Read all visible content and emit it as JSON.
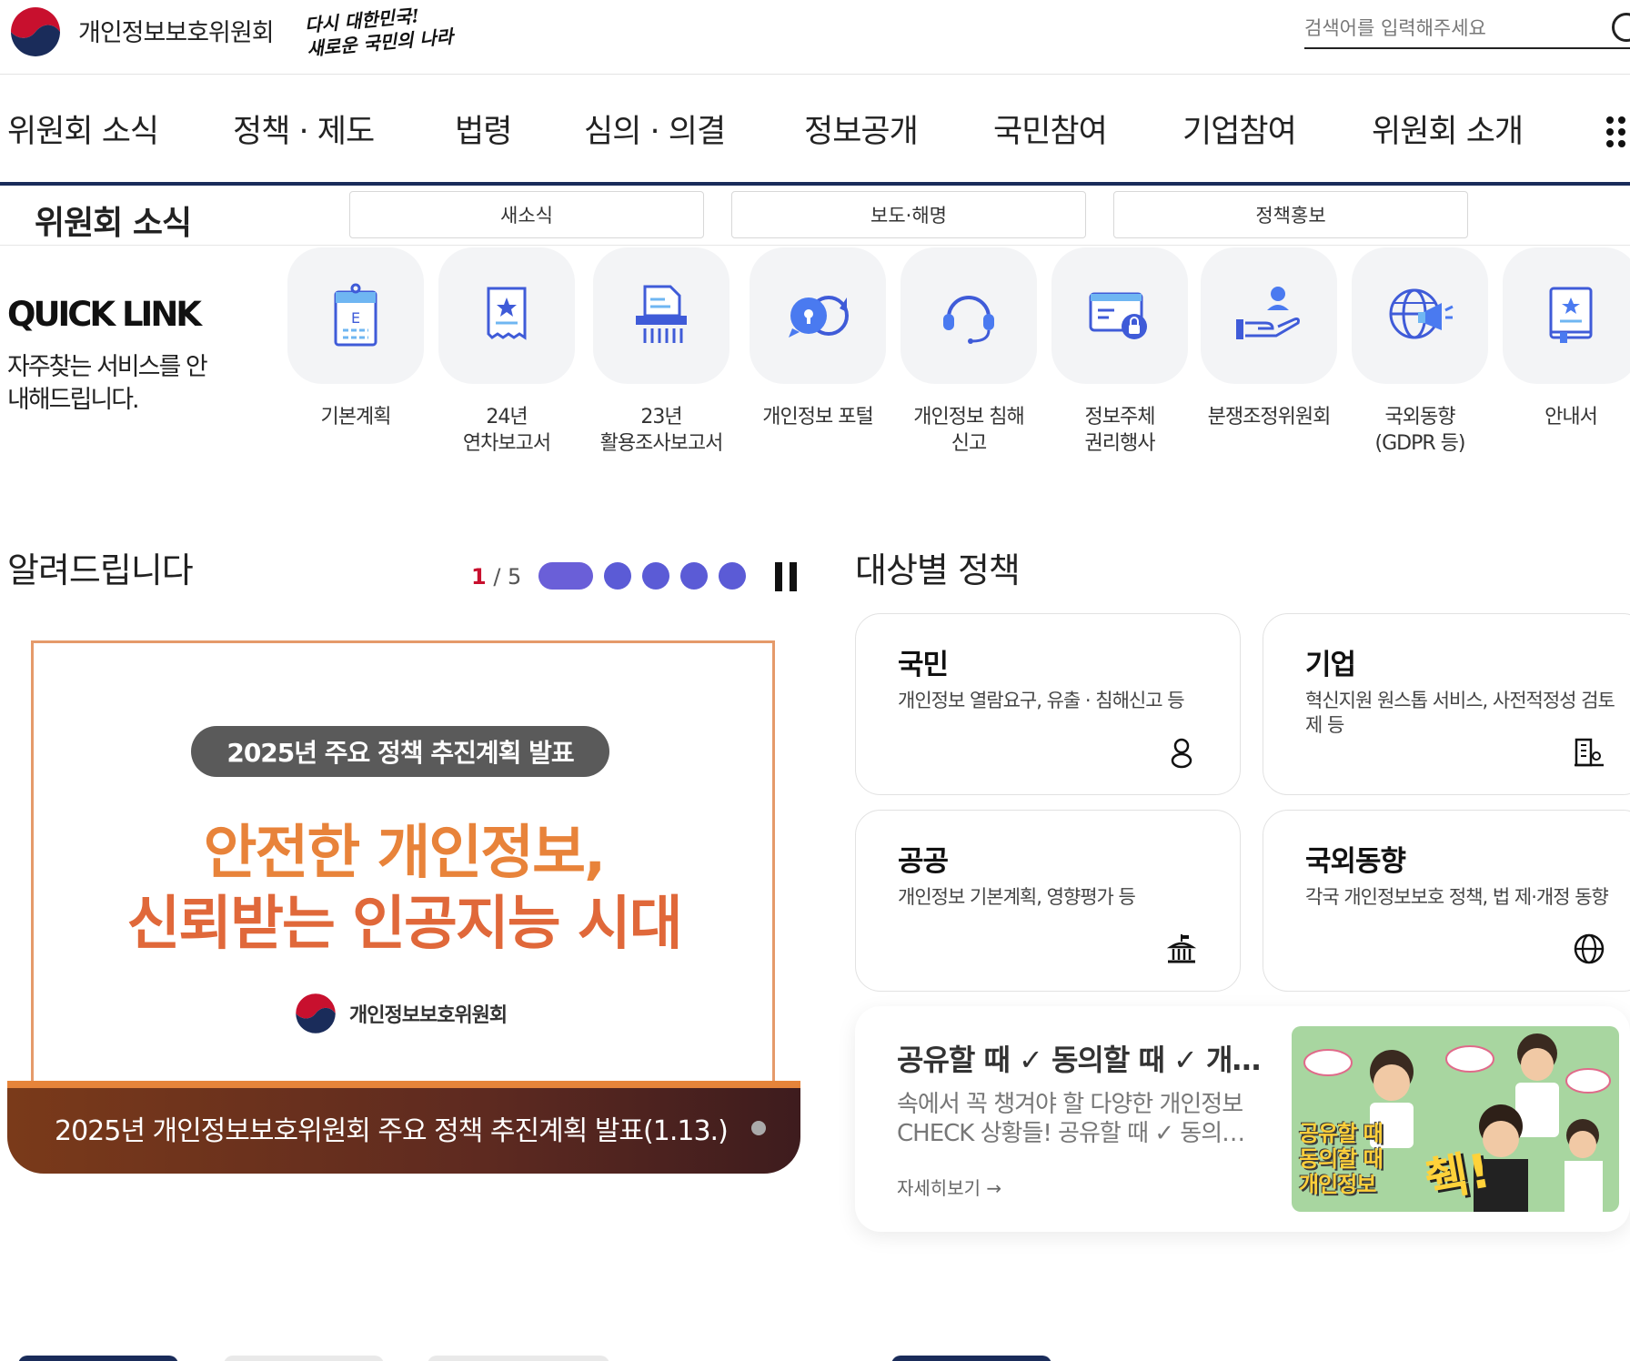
{
  "header": {
    "org_name": "개인정보보호위원회",
    "slogan_line1": "다시 대한민국!",
    "slogan_line2": "새로운 국민의 나라",
    "search_placeholder": "검색어를 입력해주세요"
  },
  "gnb": {
    "items": [
      "위원회 소식",
      "정책 · 제도",
      "법령",
      "심의 · 의결",
      "정보공개",
      "국민참여",
      "기업참여",
      "위원회 소개"
    ]
  },
  "lnb": {
    "title": "위원회 소식",
    "tabs": [
      "새소식",
      "보도·해명",
      "정책홍보"
    ]
  },
  "quicklink": {
    "title": "QUICK LINK",
    "description": "자주찾는 서비스를 안내해드립니다.",
    "items": [
      {
        "label": "기본계획",
        "icon": "plan-document-icon"
      },
      {
        "label": "24년\n연차보고서",
        "icon": "annual-report-icon"
      },
      {
        "label": "23년\n활용조사보고서",
        "icon": "survey-report-icon"
      },
      {
        "label": "개인정보 포털",
        "icon": "portal-chat-icon"
      },
      {
        "label": "개인정보 침해\n신고",
        "icon": "headset-icon"
      },
      {
        "label": "정보주체\n권리행사",
        "icon": "data-lock-icon"
      },
      {
        "label": "분쟁조정위원회",
        "icon": "mediation-hand-icon"
      },
      {
        "label": "국외동향\n(GDPR 등)",
        "icon": "globe-megaphone-icon"
      },
      {
        "label": "안내서",
        "icon": "guidebook-icon"
      }
    ]
  },
  "notice": {
    "title": "알려드립니다",
    "pager_current": "1",
    "pager_total": "/ 5",
    "banner": {
      "pill": "2025년 주요 정책 추진계획 발표",
      "headline1": "안전한 개인정보,",
      "headline2": "신뢰받는 인공지능 시대",
      "org": "개인정보보호위원회",
      "caption": "2025년 개인정보보호위원회 주요 정책 추진계획 발표(1.13.)"
    }
  },
  "policy": {
    "title": "대상별 정책",
    "cards": [
      {
        "title": "국민",
        "desc": "개인정보 열람요구, 유출 · 침해신고 등",
        "icon": "person-icon"
      },
      {
        "title": "기업",
        "desc": "혁신지원 원스톱 서비스, 사전적정성 검토제 등",
        "icon": "building-icon"
      },
      {
        "title": "공공",
        "desc": "개인정보 기본계획, 영향평가 등",
        "icon": "public-office-icon"
      },
      {
        "title": "국외동향",
        "desc": "각국 개인정보보호 정책, 법 제·개정 동향",
        "icon": "globe-icon"
      }
    ]
  },
  "feature": {
    "title": "공유할 때 ✓ 동의할 때 ✓ 개…",
    "desc": "속에서 꼭 챙겨야 할 다양한 개인정보 CHECK 상황들! 공유할 때 ✓ 동의…",
    "more": "자세히보기 →",
    "img_text1": "공유할 때",
    "img_text2": "동의할 때",
    "img_text3": "개인정보",
    "img_emph": "췍!"
  },
  "colors": {
    "nav_border": "#1a2c5a",
    "accent_purple": "#5b5bd6",
    "pager_red": "#c8102e",
    "banner_orange": "#e8833a"
  }
}
